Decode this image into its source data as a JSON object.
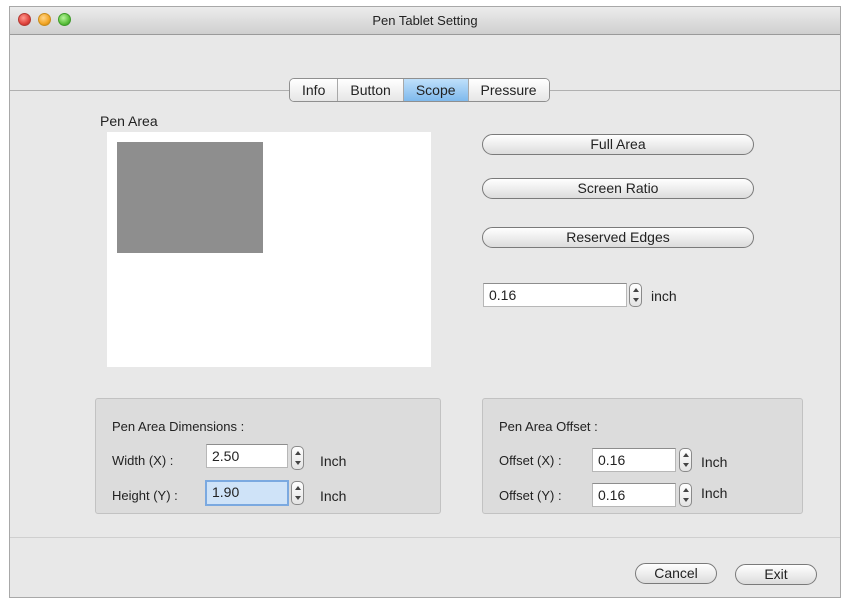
{
  "window": {
    "title": "Pen Tablet Setting"
  },
  "tabs": [
    {
      "label": "Info",
      "active": false
    },
    {
      "label": "Button",
      "active": false
    },
    {
      "label": "Scope",
      "active": true
    },
    {
      "label": "Pressure",
      "active": false
    }
  ],
  "pen_area": {
    "label": "Pen Area",
    "preview_fill_color": "#8e8e8e"
  },
  "actions": {
    "full_area": "Full Area",
    "screen_ratio": "Screen Ratio",
    "reserved_edges": "Reserved Edges",
    "edge_value": "0.16",
    "edge_unit": "inch"
  },
  "dimensions": {
    "title": "Pen Area Dimensions :",
    "width_label": "Width  (X) :",
    "width_value": "2.50",
    "width_unit": "Inch",
    "height_label": "Height (Y) :",
    "height_value": "1.90",
    "height_unit": "Inch"
  },
  "offset": {
    "title": "Pen Area Offset :",
    "x_label": "Offset (X) :",
    "x_value": "0.16",
    "x_unit": "Inch",
    "y_label": "Offset (Y) :",
    "y_value": "0.16",
    "y_unit": "Inch"
  },
  "footer": {
    "cancel": "Cancel",
    "exit": "Exit"
  },
  "colors": {
    "active_tab": "#7fb9ec",
    "focus_ring": "#7ba9e0"
  }
}
